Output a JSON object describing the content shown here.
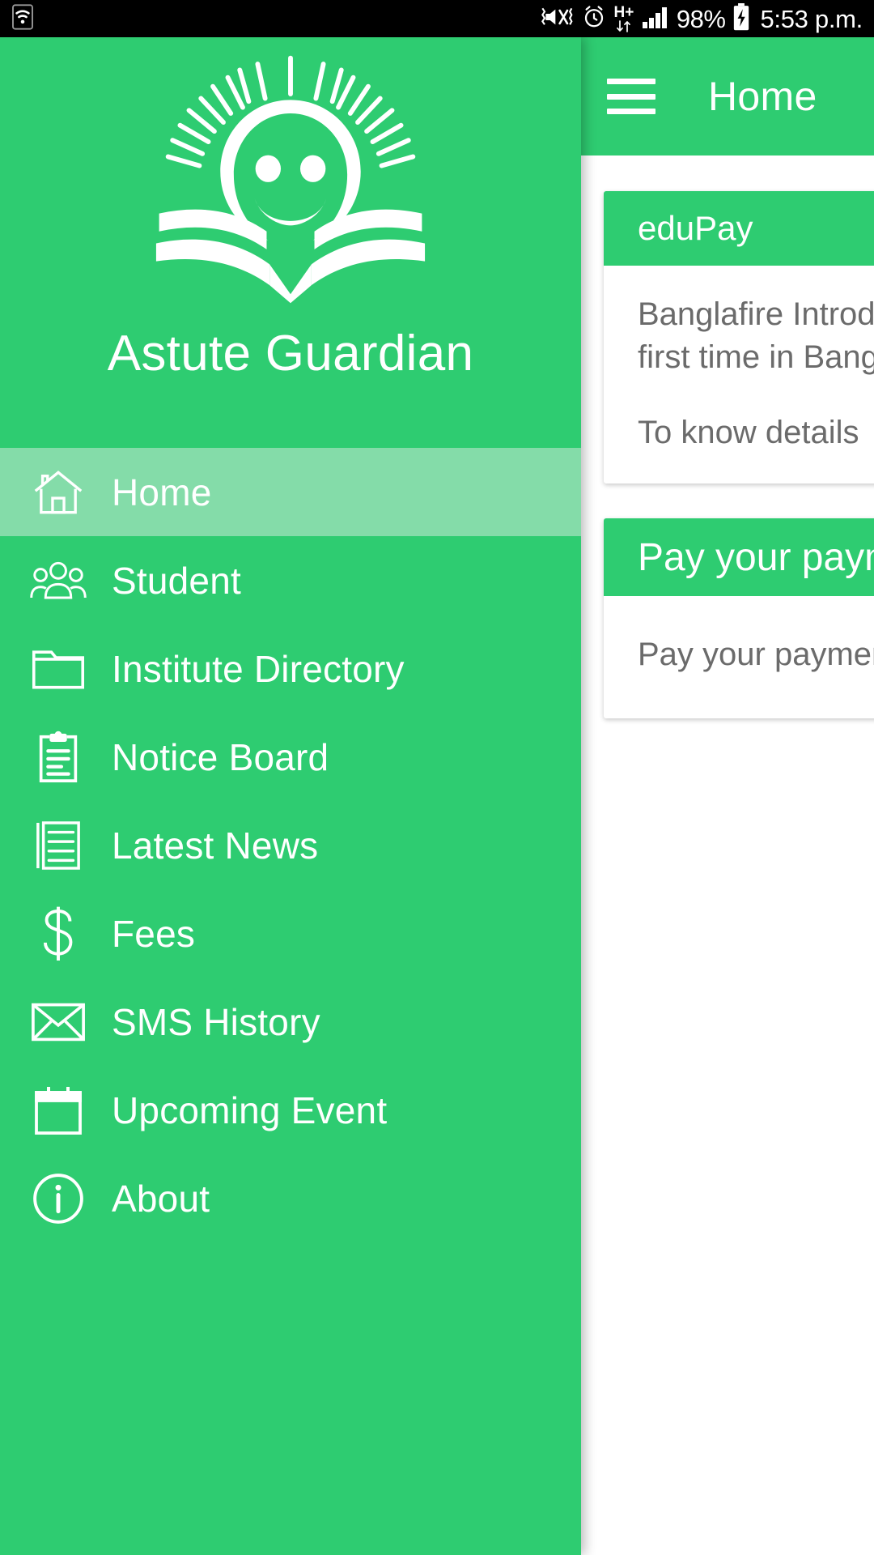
{
  "status_bar": {
    "wifi_icon": "wifi-icon",
    "vibrate_icon": "vibrate-mute-icon",
    "alarm_icon": "alarm-clock-icon",
    "network_type": "H+",
    "data_arrows_icon": "data-transfer-arrows-icon",
    "signal_icon": "signal-bars-icon",
    "battery_percent": "98%",
    "battery_icon": "battery-charging-icon",
    "clock": "5:53 p.m."
  },
  "app_bar": {
    "menu_icon": "hamburger-menu-icon",
    "title": "Home"
  },
  "drawer": {
    "logo_icon": "sun-smiley-book-logo",
    "title": "Astute Guardian",
    "items": [
      {
        "label": "Home",
        "icon": "home-icon",
        "selected": true
      },
      {
        "label": "Student",
        "icon": "students-group-icon",
        "selected": false
      },
      {
        "label": "Institute Directory",
        "icon": "folder-icon",
        "selected": false
      },
      {
        "label": "Notice Board",
        "icon": "clipboard-icon",
        "selected": false
      },
      {
        "label": "Latest News",
        "icon": "news-document-icon",
        "selected": false
      },
      {
        "label": "Fees",
        "icon": "dollar-sign-icon",
        "selected": false
      },
      {
        "label": "SMS History",
        "icon": "envelope-icon",
        "selected": false
      },
      {
        "label": "Upcoming Event",
        "icon": "calendar-icon",
        "selected": false
      },
      {
        "label": "About",
        "icon": "info-circle-icon",
        "selected": false
      }
    ]
  },
  "content": {
    "cards": [
      {
        "title": "eduPay",
        "body_line1": "Banglafire Introdu",
        "body_line2": "first time in Bangla",
        "sub_label": "To know details",
        "link_icon": "link-circle-icon"
      },
      {
        "title": "Pay your payme",
        "body_line1": "Pay your payment",
        "body_line2": "",
        "sub_label": "",
        "link_icon": ""
      }
    ]
  },
  "colors": {
    "brand_green": "#2ECC71",
    "selected_green": "#84DCA9",
    "status_bar_bg": "#000000",
    "body_text": "#6b6b6b"
  }
}
